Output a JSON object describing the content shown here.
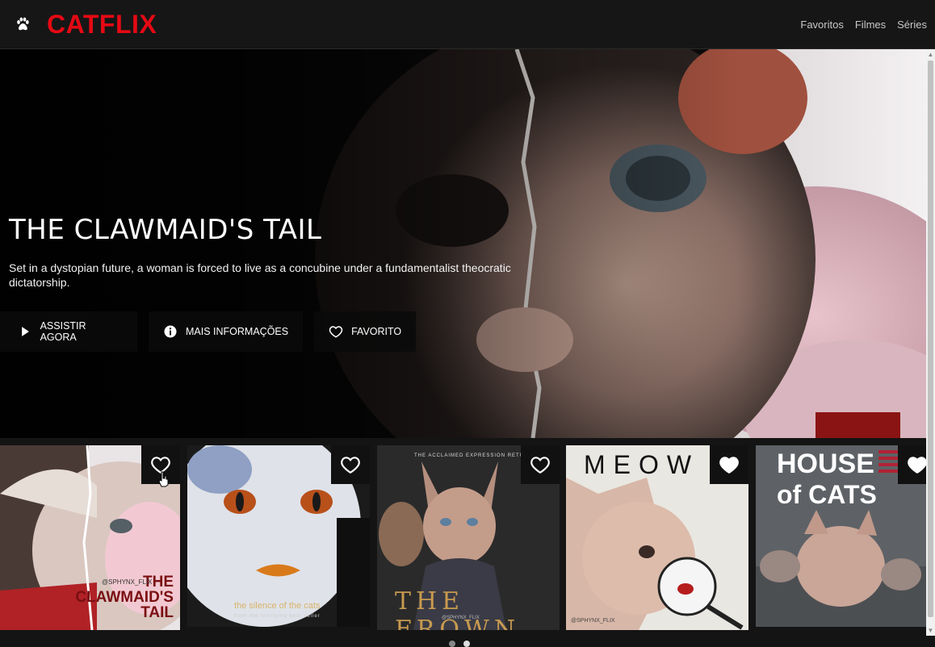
{
  "brand": {
    "logo": "CATFLIX"
  },
  "nav": {
    "items": [
      "Favoritos",
      "Filmes",
      "Séries"
    ]
  },
  "hero": {
    "title": "THE CLAWMAID'S TAIL",
    "description": "Set in a dystopian future, a woman is forced to live as a concubine under a fundamentalist theocratic dictatorship.",
    "buttons": {
      "watch": "ASSISTIR AGORA",
      "info": "MAIS INFORMAÇÕES",
      "favorite": "FAVORITO"
    },
    "corner_text": "THE"
  },
  "cards": [
    {
      "title_lines": [
        "THE",
        "CLAWMAID'S",
        "TAIL"
      ],
      "credit": "@SPHYNX_FLIX",
      "favorited": false
    },
    {
      "title": "the silence of the cats",
      "tagline": "from the terrifying best seller",
      "favorited": false
    },
    {
      "title": "THE FROWN",
      "header": "THE ACCLAIMED EXPRESSION RETURNS",
      "credit": "@SPHYNX_FLIX",
      "favorited": false
    },
    {
      "title": "MEOW",
      "credit": "@SPHYNX_FLIX",
      "favorited": true
    },
    {
      "title_lines": [
        "HOUSE",
        "of CATS"
      ],
      "favorited": true
    }
  ],
  "carousel": {
    "pages": 2,
    "active": 1
  },
  "colors": {
    "brand_red": "#e50914",
    "background": "#141414"
  }
}
